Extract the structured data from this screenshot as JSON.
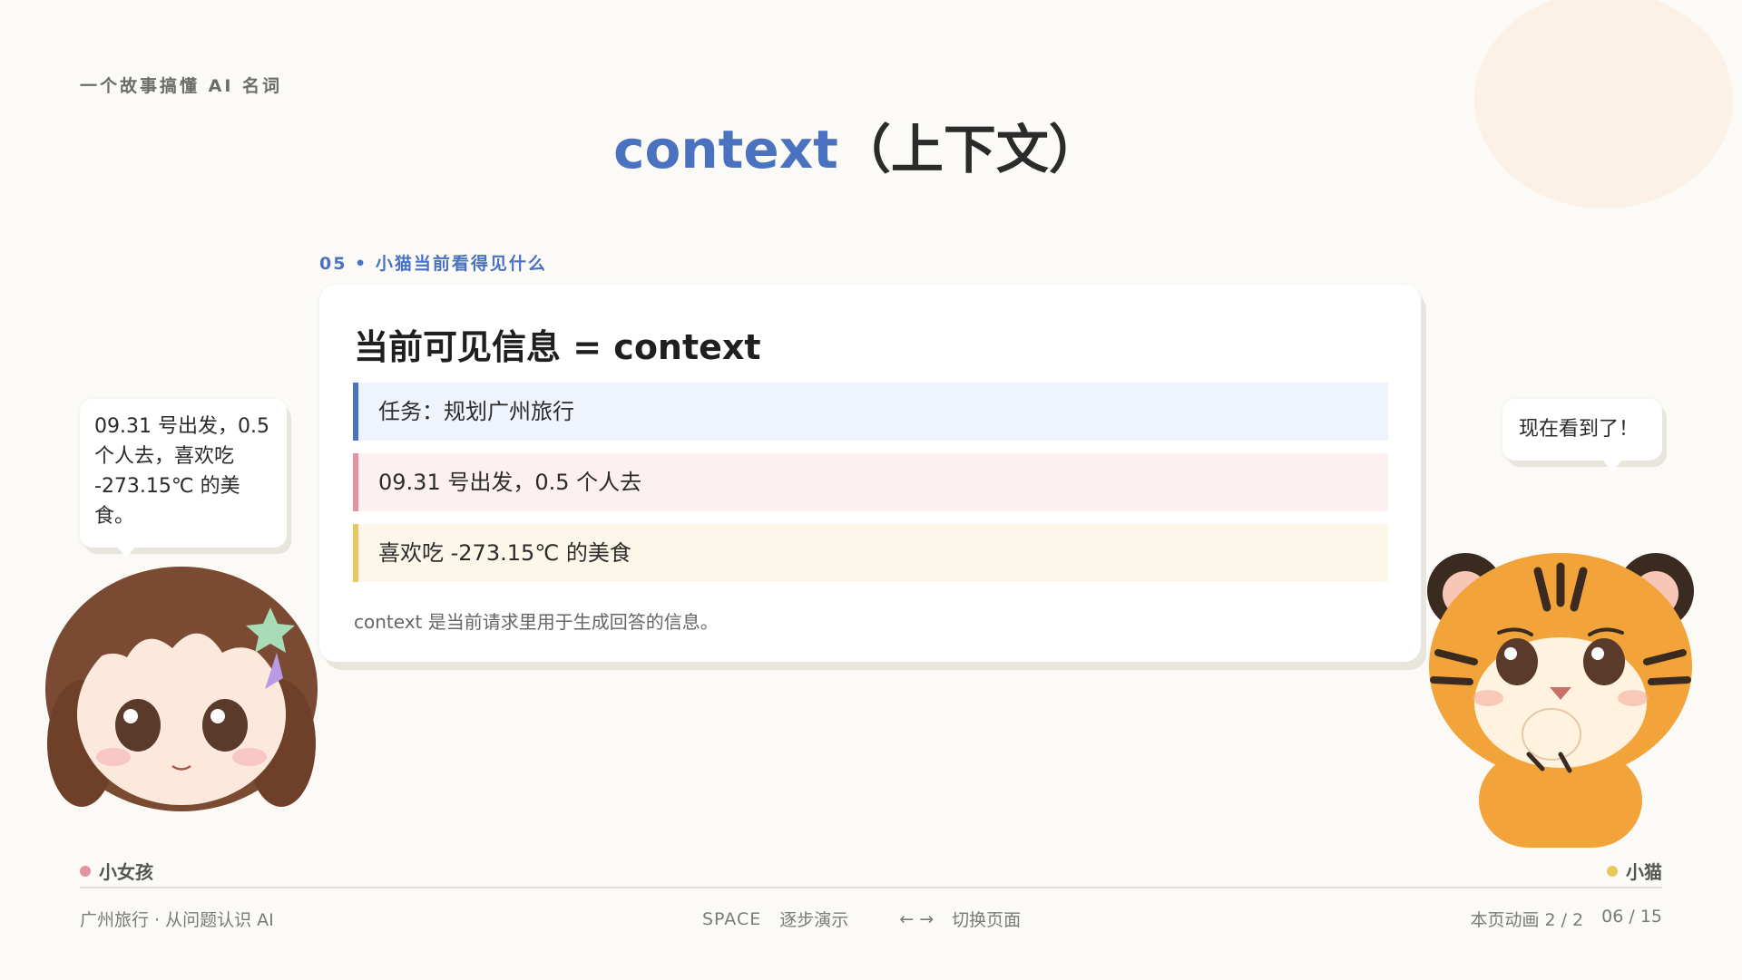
{
  "header": {
    "series": "一个故事搞懂 AI 名词",
    "title_keyword": "context",
    "title_rest": "（上下文）"
  },
  "section": {
    "label": "05 • 小猫当前看得见什么"
  },
  "card": {
    "title": "当前可见信息 = context",
    "items": [
      {
        "text": "任务：规划广州旅行",
        "accent": "#4a72c0"
      },
      {
        "text": "09.31 号出发，0.5 个人去",
        "accent": "#e491a2"
      },
      {
        "text": "喜欢吃 -273.15℃ 的美食",
        "accent": "#e8c75d"
      }
    ],
    "note": "context 是当前请求里用于生成回答的信息。"
  },
  "bubbles": {
    "girl": "09.31 号出发，0.5 个人去，喜欢吃 -273.15℃ 的美食。",
    "tiger": "现在看到了！"
  },
  "characters": {
    "girl_name": "小女孩",
    "tiger_name": "小猫"
  },
  "footer": {
    "left": "广州旅行 · 从问题认识 AI",
    "space_key": "SPACE",
    "space_action": "逐步演示",
    "arrows": "←  →",
    "arrows_action": "切换页面",
    "animation": "本页动画 2 / 2",
    "page": "06 / 15"
  },
  "colors": {
    "accent_blue": "#4a72c0",
    "accent_pink": "#e491a2",
    "accent_yellow": "#e8c75d",
    "background": "#fbfaf6"
  }
}
